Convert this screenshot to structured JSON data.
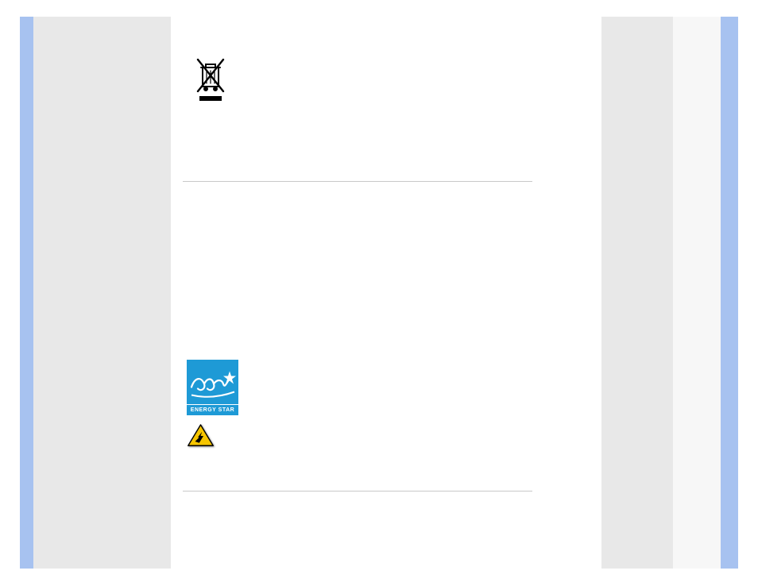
{
  "stripes": {
    "left_blue": "#a7c2f0",
    "left_gray": "#e8e8e8",
    "right_gray1": "#e8e8e8",
    "right_gray2": "#f7f7f7",
    "right_blue": "#a7c2f0"
  },
  "icons": {
    "weee": "weee-crossed-bin-icon",
    "energy_star": "energy-star-icon",
    "caution": "esd-caution-icon"
  },
  "energy_star": {
    "label": "ENERGY STAR"
  }
}
